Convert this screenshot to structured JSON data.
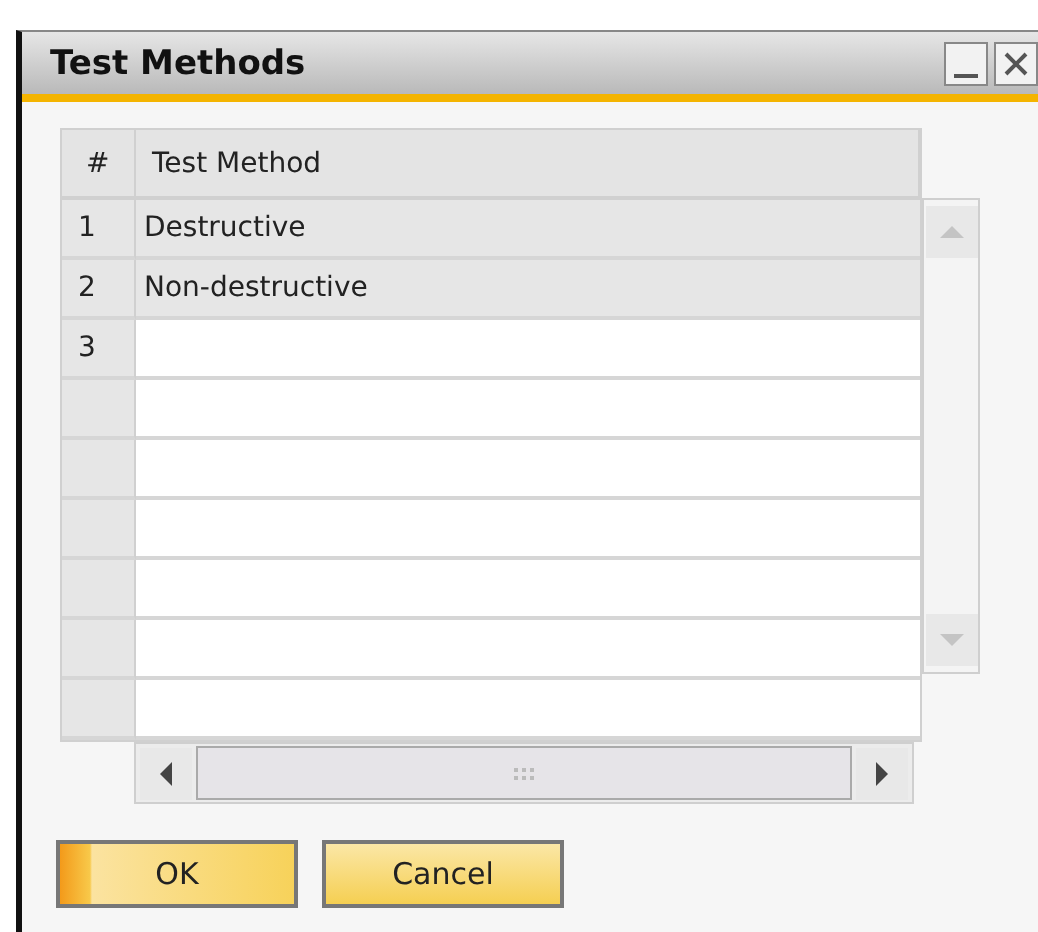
{
  "window": {
    "title": "Test Methods"
  },
  "table": {
    "columns": [
      "#",
      "Test Method"
    ],
    "rows": [
      {
        "number": "1",
        "test_method": "Destructive"
      },
      {
        "number": "2",
        "test_method": "Non-destructive"
      },
      {
        "number": "3"
      }
    ]
  },
  "buttons": [
    {
      "label": "OK",
      "default": true
    },
    {
      "label": "Cancel",
      "default": false
    }
  ]
}
